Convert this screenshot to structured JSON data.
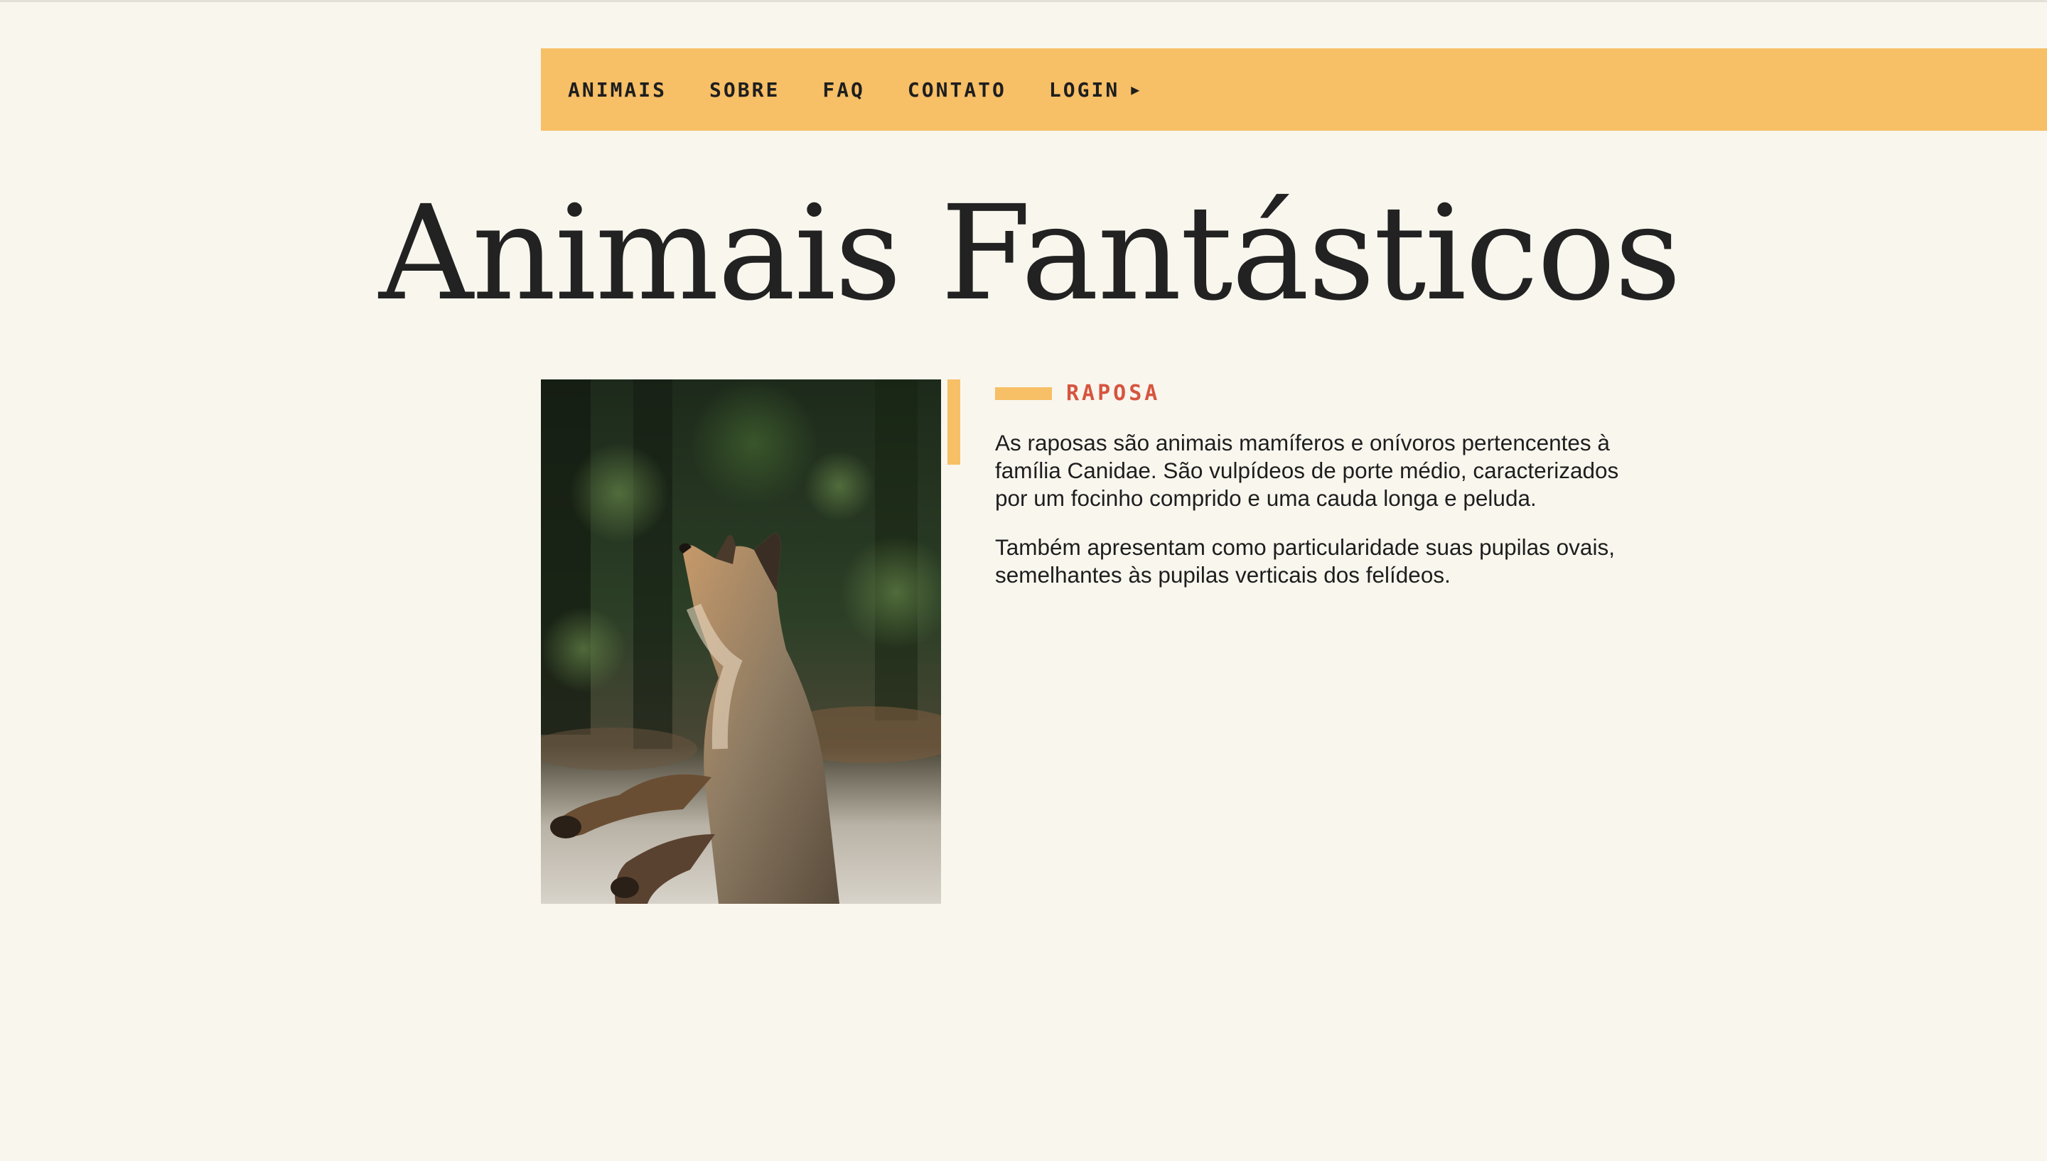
{
  "nav": {
    "items": [
      {
        "label": "ANIMAIS"
      },
      {
        "label": "SOBRE"
      },
      {
        "label": "FAQ"
      },
      {
        "label": "CONTATO"
      },
      {
        "label": "LOGIN",
        "icon": "play-arrow-icon",
        "icon_glyph": "▶"
      }
    ]
  },
  "page": {
    "title": "Animais Fantásticos"
  },
  "animal": {
    "image_icon": "fox-photo",
    "label": "RAPOSA",
    "paragraphs": [
      "As raposas são animais mamíferos e onívoros pertencentes à família Canidae. São vulpídeos de porte médio, caracterizados por um focinho comprido e uma cauda longa e peluda.",
      "Também apresentam como particularidade suas pupilas ovais, semelhantes às pupilas verticais dos felídeos."
    ]
  },
  "colors": {
    "background": "#f9f6ee",
    "accent": "#f7bf66",
    "label": "#d6553f",
    "text": "#222222"
  }
}
